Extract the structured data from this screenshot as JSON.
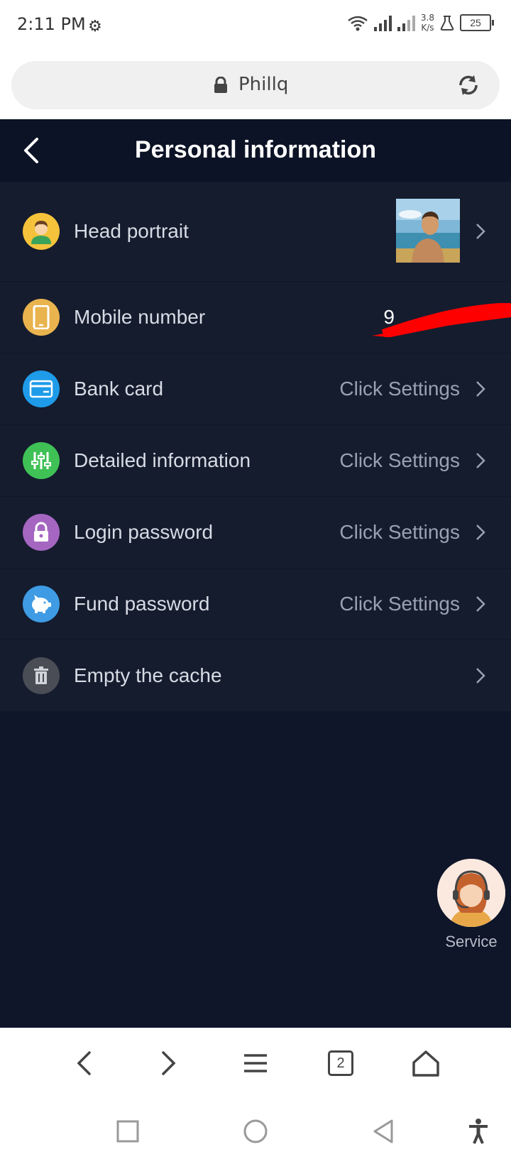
{
  "status_bar": {
    "time": "2:11 PM",
    "network_speed_value": "3.8",
    "network_speed_unit": "K/s",
    "battery": "25"
  },
  "browser": {
    "url": "Phillq",
    "tab_count": "2"
  },
  "header": {
    "title": "Personal information"
  },
  "rows": [
    {
      "label": "Head portrait",
      "value": "",
      "icon": "user-face-icon",
      "color": "#f5c33b"
    },
    {
      "label": "Mobile number",
      "value": "9",
      "icon": "phone-icon",
      "color": "#e9b34e"
    },
    {
      "label": "Bank card",
      "value": "Click Settings",
      "icon": "bank-card-icon",
      "color": "#1e9be9"
    },
    {
      "label": "Detailed information",
      "value": "Click Settings",
      "icon": "sliders-icon",
      "color": "#3fc156"
    },
    {
      "label": "Login password",
      "value": "Click Settings",
      "icon": "lock-icon",
      "color": "#a566c2"
    },
    {
      "label": "Fund password",
      "value": "Click Settings",
      "icon": "piggy-bank-icon",
      "color": "#3f9be4"
    },
    {
      "label": "Empty the cache",
      "value": "",
      "icon": "trash-icon",
      "color": "#4a4d55"
    }
  ],
  "service": {
    "label": "Service"
  },
  "colors": {
    "app_background": "#0f1629",
    "list_background": "#151c2e",
    "header_background": "#0c1326",
    "redaction": "#ff0000"
  }
}
